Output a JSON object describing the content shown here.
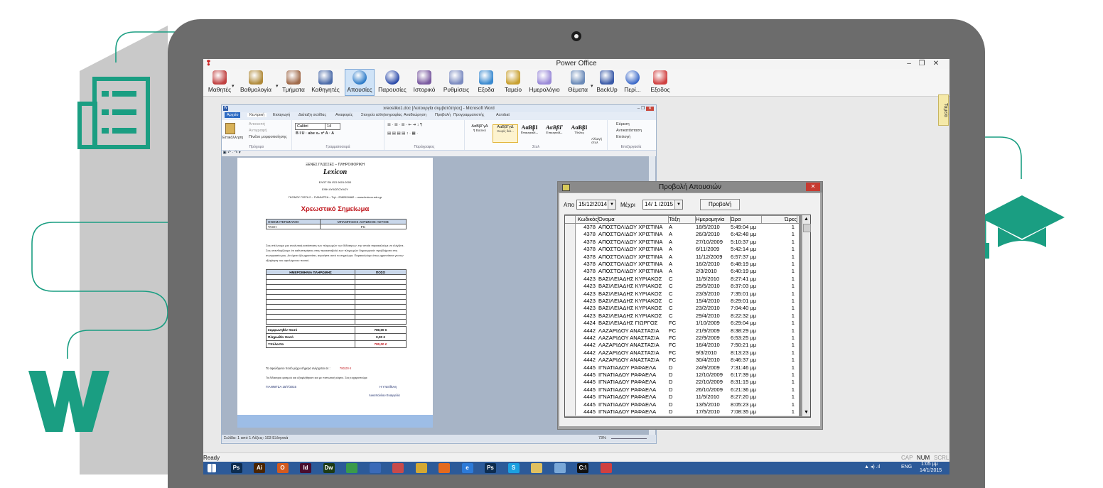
{
  "app": {
    "title": "Power Office",
    "logo": "power-office-logo",
    "window_controls": [
      "–",
      "❐",
      "✕"
    ]
  },
  "toolbar": [
    {
      "label": "Μαθητές",
      "icon": "students-icon",
      "color": "#c04040",
      "menu": true
    },
    {
      "label": "Βαθμολογία",
      "icon": "grades-icon",
      "color": "#b08a3a",
      "menu": true
    },
    {
      "label": "Τμήματα",
      "icon": "classes-icon",
      "color": "#a06a4a",
      "menu": false
    },
    {
      "label": "Καθηγητές",
      "icon": "teachers-icon",
      "color": "#4a6aa8",
      "menu": false
    },
    {
      "label": "Απουσίες",
      "icon": "absences-icon",
      "color": "#2a7ac8",
      "menu": false,
      "active": true
    },
    {
      "label": "Παρουσίες",
      "icon": "attendance-icon",
      "color": "#2848a8",
      "menu": false
    },
    {
      "label": "Ιστορικό",
      "icon": "history-icon",
      "color": "#7a5aa0",
      "menu": false
    },
    {
      "label": "Ρυθμίσεις",
      "icon": "settings-icon",
      "color": "#7a8ac0",
      "menu": false
    },
    {
      "label": "Εξοδα",
      "icon": "expenses-icon",
      "color": "#3a8ad0",
      "menu": false
    },
    {
      "label": "Ταμείο",
      "icon": "cashier-icon",
      "color": "#c8a030",
      "menu": false
    },
    {
      "label": "Ημερολόγιο",
      "icon": "calendar-icon",
      "color": "#9a8ad8",
      "menu": false
    },
    {
      "label": "Θέματα",
      "icon": "topics-icon",
      "color": "#6a8ab8",
      "menu": true
    },
    {
      "label": "BackUp",
      "icon": "backup-icon",
      "color": "#3a5aa8",
      "menu": false
    },
    {
      "label": "Περί...",
      "icon": "about-icon",
      "color": "#3a68c8",
      "menu": false
    },
    {
      "label": "Εξοδος",
      "icon": "exit-icon",
      "color": "#d04040",
      "menu": false
    }
  ],
  "side_tab": "Ταμείο",
  "statusbar": {
    "left": "Ready",
    "caps": "CAP",
    "num": "NUM",
    "scrl": "SCRL"
  },
  "taskbar": {
    "apps": [
      {
        "name": "start-icon",
        "label": "",
        "color": "#2c5a99"
      },
      {
        "name": "photoshop-icon",
        "label": "Ps",
        "color": "#0d2c4f"
      },
      {
        "name": "illustrator-icon",
        "label": "Ai",
        "color": "#4a2400"
      },
      {
        "name": "office-icon",
        "label": "O",
        "color": "#d35a1e"
      },
      {
        "name": "indesign-icon",
        "label": "Id",
        "color": "#4a0d2e"
      },
      {
        "name": "dreamweaver-icon",
        "label": "Dw",
        "color": "#1d3a14"
      },
      {
        "name": "leaf-app-icon",
        "label": "",
        "color": "#3a9a4a"
      },
      {
        "name": "network-icon",
        "label": "",
        "color": "#3a6ab8"
      },
      {
        "name": "ps-tool-icon",
        "label": "",
        "color": "#c84a4a"
      },
      {
        "name": "chrome-icon",
        "label": "",
        "color": "#d4a832"
      },
      {
        "name": "firefox-icon",
        "label": "",
        "color": "#e36a1e"
      },
      {
        "name": "ie-icon",
        "label": "e",
        "color": "#2c7ad8"
      },
      {
        "name": "photoshop2-icon",
        "label": "Ps",
        "color": "#0d2c4f"
      },
      {
        "name": "skype-icon",
        "label": "S",
        "color": "#1ba0e0"
      },
      {
        "name": "folder-icon",
        "label": "",
        "color": "#e0c060"
      },
      {
        "name": "tablet-icon",
        "label": "",
        "color": "#7aa8d8"
      },
      {
        "name": "cmd-icon",
        "label": "C:\\",
        "color": "#111111"
      },
      {
        "name": "person-icon",
        "label": "",
        "color": "#d04040"
      }
    ],
    "lang": "ENG",
    "time": "1:05 μμ",
    "date": "14/1/2015"
  },
  "word": {
    "title": "xreostiko1.doc [Λειτουργία συμβατότητας] - Microsoft Word",
    "tabs": [
      "Αρχείο",
      "Κεντρική",
      "Εισαγωγή",
      "Διάταξη σελίδας",
      "Αναφορές",
      "Στοιχεία αλληλογραφίας",
      "Αναθεώρηση",
      "Προβολή",
      "Προγραμματιστής",
      "Acrobat"
    ],
    "clipboard": {
      "paste": "Επικόλληση",
      "cut": "Αποκοπή",
      "copy": "Αντιγραφή",
      "painter": "Πινέλο μορφοποίησης",
      "group": "Πρόχειρο"
    },
    "font": {
      "name": "Calibri",
      "size": "14",
      "group": "Γραμματοσειρά"
    },
    "paragraph_group": "Παράγραφος",
    "styles": [
      {
        "sample": "ΑαΒβΓγΔ",
        "name": "¶ Βασικό"
      },
      {
        "sample": "ΑαΒβΓγΔ",
        "name": "Χωρίς διά..."
      },
      {
        "sample": "ΑαΒβΙ",
        "name": "Επικεφαλί..."
      },
      {
        "sample": "ΑαΒβΓ",
        "name": "Επικεφαλί..."
      },
      {
        "sample": "ΑαΒβΙ",
        "name": "Τίτλος"
      }
    ],
    "styles_group": "Στυλ",
    "change_styles": "Αλλαγή στυλ",
    "editing": {
      "find": "Εύρεση",
      "replace": "Αντικατάσταση",
      "select": "Επιλογή",
      "group": "Επεξεργασία"
    },
    "status": "Σελίδα: 1 από 1   Λέξεις: 103   Ελληνικά",
    "zoom": "73%",
    "document": {
      "header1": "ΞΕΝΕΣ ΓΛΩΣΣΕΣ – ΠΛΗΡΟΦΟΡΙΚΗ",
      "brand": "Lexicon",
      "header2": "ΕΛΟΤ ΕΝ ISO 9001:2000",
      "header3": "ΕΦΗ ΛΥΚΟΠΟΥΛΟΥ",
      "address": "ΓΚΟΝΟΥ ΓΙΩΤΑ 2 – ΓΙΑΝΝΙΤΣΑ – Τηλ.: 2382024662 – www.lexicon.edu.gr",
      "doc_title": "Χρεωστικό Σημείωμα",
      "name_label": "ΟΝΟΜΑΤΕΠΩΝΥΜΟ",
      "name_value": "ΜΠΑΜΠΑΣΗΣ ΑΝΤΩΝΙΟΣ-ΑΕΤΙΟΣ",
      "class_label": "ΤΑΞΗ",
      "class_value": "FC",
      "paragraph": "Σας στέλνουμε μια αναλυτική κατάσταση των πληρωμών των διδάκτρων, την οποία παρακαλούμε να ελέγξετε. Σας υπενθυμίζουμε ότι καθυστερήσεις στην προκαταβολή των πληρωμών δημιουργούν προβλήματα στη συνεργασία μας. Αν έχετε ήδη φροντίσει, αγνοήστε αυτό το σημείωμα. Παρακαλούμε όπως φροντίσετε για την εξόφληση του οφειλόμενου ποσού.",
      "col_date": "ΗΜΕΡΟΜΗΝΙΑ ΠΛΗΡΩΜΗΣ",
      "col_amount": "ΠΟΣΟ",
      "agreed_label": "Συμφωνηθέν ποσό",
      "agreed_value": "780,00 €",
      "paid_label": "Πληρωθέν ποσό",
      "paid_value": "0,00 €",
      "balance_label": "Υπόλοιπο",
      "balance_value": "780,00 €",
      "due_text": "Το οφειλόμενο ποσό μέχρι σήμερα ανέρχεται σε :",
      "due_value": "780,00 €",
      "note": "Τα δίδακτρα ορισμού και εξοφλήθηκαν και με πιστωτική κάρτα. Σας ευχαριστούμε",
      "place_date": "ΓΙΑΝΝΙΤΣΑ  15/7/2015",
      "sign_role": "Η Υπεύθυνη",
      "sign_name": "Λυκοπούλου Ευαγγελία"
    }
  },
  "absences": {
    "title": "Προβολή Απουσιών",
    "from_label": "Απο",
    "from_value": "15/12/2014",
    "to_label": "Μέχρι",
    "to_value": "14/ 1 /2015",
    "view_button": "Προβολή",
    "columns": [
      "Κωδικός",
      "Όνομα",
      "Τάξη",
      "Ημερομηνία",
      "Ώρα",
      "Ώρες"
    ],
    "rows": [
      [
        "4378",
        "ΑΠΟΣΤΟΛΙΔΟΥ ΧΡΙΣΤΙΝΑ",
        "A",
        "18/5/2010",
        "5:49:04 μμ",
        "1"
      ],
      [
        "4378",
        "ΑΠΟΣΤΟΛΙΔΟΥ ΧΡΙΣΤΙΝΑ",
        "A",
        "26/3/2010",
        "6:42:48 μμ",
        "1"
      ],
      [
        "4378",
        "ΑΠΟΣΤΟΛΙΔΟΥ ΧΡΙΣΤΙΝΑ",
        "A",
        "27/10/2009",
        "5:10:37 μμ",
        "1"
      ],
      [
        "4378",
        "ΑΠΟΣΤΟΛΙΔΟΥ ΧΡΙΣΤΙΝΑ",
        "A",
        "6/11/2009",
        "5:42:14 μμ",
        "1"
      ],
      [
        "4378",
        "ΑΠΟΣΤΟΛΙΔΟΥ ΧΡΙΣΤΙΝΑ",
        "A",
        "11/12/2009",
        "6:57:37 μμ",
        "1"
      ],
      [
        "4378",
        "ΑΠΟΣΤΟΛΙΔΟΥ ΧΡΙΣΤΙΝΑ",
        "A",
        "16/2/2010",
        "6:48:19 μμ",
        "1"
      ],
      [
        "4378",
        "ΑΠΟΣΤΟΛΙΔΟΥ ΧΡΙΣΤΙΝΑ",
        "A",
        "2/3/2010",
        "6:40:19 μμ",
        "1"
      ],
      [
        "4423",
        "ΒΑΣΙΛΕΙΑΔΗΣ ΚΥΡΙΑΚΟΣ",
        "C",
        "11/5/2010",
        "8:27:41 μμ",
        "1"
      ],
      [
        "4423",
        "ΒΑΣΙΛΕΙΑΔΗΣ ΚΥΡΙΑΚΟΣ",
        "C",
        "25/5/2010",
        "8:37:03 μμ",
        "1"
      ],
      [
        "4423",
        "ΒΑΣΙΛΕΙΑΔΗΣ ΚΥΡΙΑΚΟΣ",
        "C",
        "23/3/2010",
        "7:35:01 μμ",
        "1"
      ],
      [
        "4423",
        "ΒΑΣΙΛΕΙΑΔΗΣ ΚΥΡΙΑΚΟΣ",
        "C",
        "15/4/2010",
        "8:29:01 μμ",
        "1"
      ],
      [
        "4423",
        "ΒΑΣΙΛΕΙΑΔΗΣ ΚΥΡΙΑΚΟΣ",
        "C",
        "23/2/2010",
        "7:04:40 μμ",
        "1"
      ],
      [
        "4423",
        "ΒΑΣΙΛΕΙΑΔΗΣ ΚΥΡΙΑΚΟΣ",
        "C",
        "29/4/2010",
        "8:22:32 μμ",
        "1"
      ],
      [
        "4424",
        "ΒΑΣΙΛΕΙΑΔΗΣ ΓΙΩΡΓΟΣ",
        "FC",
        "1/10/2009",
        "6:29:04 μμ",
        "1"
      ],
      [
        "4442",
        "ΛΑΖΑΡΙΔΟΥ ΑΝΑΣΤΑΣΙΑ",
        "FC",
        "21/9/2009",
        "8:38:29 μμ",
        "1"
      ],
      [
        "4442",
        "ΛΑΖΑΡΙΔΟΥ ΑΝΑΣΤΑΣΙΑ",
        "FC",
        "22/9/2009",
        "6:53:25 μμ",
        "1"
      ],
      [
        "4442",
        "ΛΑΖΑΡΙΔΟΥ ΑΝΑΣΤΑΣΙΑ",
        "FC",
        "16/4/2010",
        "7:50:21 μμ",
        "1"
      ],
      [
        "4442",
        "ΛΑΖΑΡΙΔΟΥ ΑΝΑΣΤΑΣΙΑ",
        "FC",
        "9/3/2010",
        "8:13:23 μμ",
        "1"
      ],
      [
        "4442",
        "ΛΑΖΑΡΙΔΟΥ ΑΝΑΣΤΑΣΙΑ",
        "FC",
        "30/4/2010",
        "8:46:37 μμ",
        "1"
      ],
      [
        "4445",
        "ΙΓΝΑΤΙΑΔΟΥ ΡΑΦΑΕΛΑ",
        "D",
        "24/9/2009",
        "7:31:46 μμ",
        "1"
      ],
      [
        "4445",
        "ΙΓΝΑΤΙΑΔΟΥ ΡΑΦΑΕΛΑ",
        "D",
        "12/10/2009",
        "6:17:39 μμ",
        "1"
      ],
      [
        "4445",
        "ΙΓΝΑΤΙΑΔΟΥ ΡΑΦΑΕΛΑ",
        "D",
        "22/10/2009",
        "8:31:15 μμ",
        "1"
      ],
      [
        "4445",
        "ΙΓΝΑΤΙΑΔΟΥ ΡΑΦΑΕΛΑ",
        "D",
        "26/10/2009",
        "6:21:36 μμ",
        "1"
      ],
      [
        "4445",
        "ΙΓΝΑΤΙΑΔΟΥ ΡΑΦΑΕΛΑ",
        "D",
        "11/5/2010",
        "8:27:20 μμ",
        "1"
      ],
      [
        "4445",
        "ΙΓΝΑΤΙΑΔΟΥ ΡΑΦΑΕΛΑ",
        "D",
        "13/5/2010",
        "8:05:23 μμ",
        "1"
      ],
      [
        "4445",
        "ΙΓΝΑΤΙΑΔΟΥ ΡΑΦΑΕΛΑ",
        "D",
        "17/5/2010",
        "7:08:35 μμ",
        "1"
      ]
    ]
  },
  "colors": {
    "teal_accent": "#1a9e82",
    "laptop_body": "#6c6c6c",
    "bg_shape": "#c8c8c8",
    "doc_title_red": "#c0161c"
  }
}
